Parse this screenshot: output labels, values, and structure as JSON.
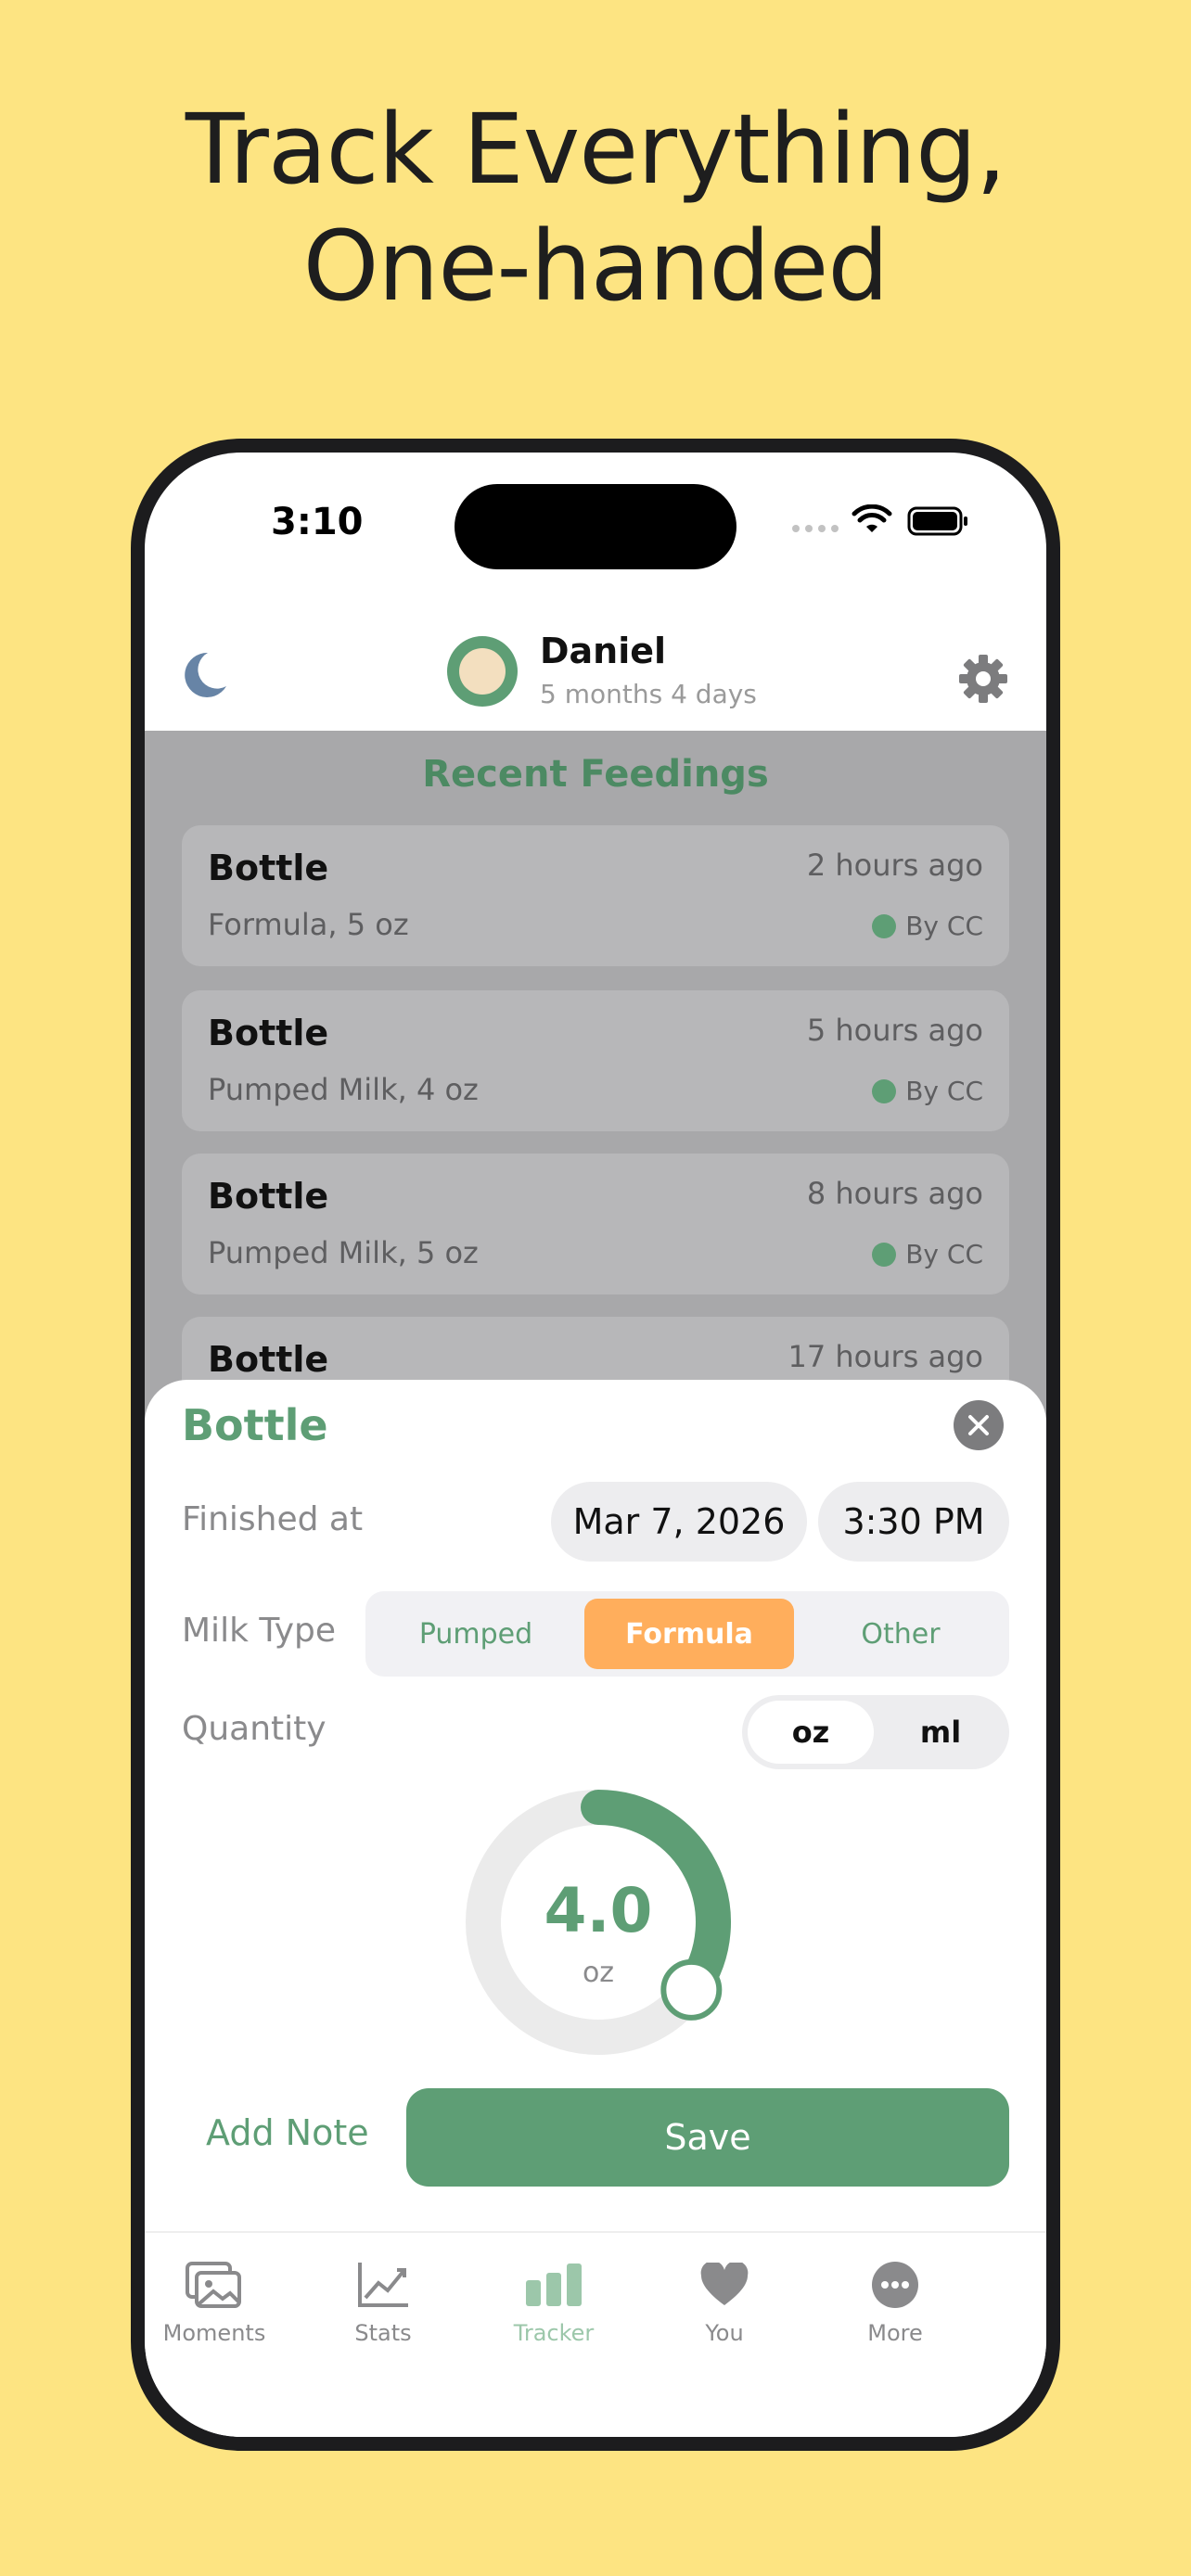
{
  "headline": {
    "line1": "Track Everything,",
    "line2": "One-handed"
  },
  "status_bar": {
    "time": "3:10"
  },
  "header": {
    "baby_name": "Daniel",
    "baby_age": "5 months 4 days"
  },
  "recent": {
    "title": "Recent Feedings",
    "items": [
      {
        "type": "Bottle",
        "detail": "Formula, 5 oz",
        "time": "2 hours ago",
        "by": "By CC"
      },
      {
        "type": "Bottle",
        "detail": "Pumped Milk, 4 oz",
        "time": "5 hours ago",
        "by": "By CC"
      },
      {
        "type": "Bottle",
        "detail": "Pumped Milk, 5 oz",
        "time": "8 hours ago",
        "by": "By CC"
      },
      {
        "type": "Bottle",
        "detail": "",
        "time": "17 hours ago",
        "by": ""
      }
    ]
  },
  "sheet": {
    "title": "Bottle",
    "finished_label": "Finished at",
    "date": "Mar 7, 2026",
    "time": "3:30 PM",
    "milk_label": "Milk Type",
    "milk_options": [
      "Pumped",
      "Formula",
      "Other"
    ],
    "milk_selected": "Formula",
    "quantity_label": "Quantity",
    "units": [
      "oz",
      "ml"
    ],
    "unit_selected": "oz",
    "quantity_value": "4.0",
    "quantity_unit": "oz",
    "dial_fraction": 0.35,
    "add_note": "Add Note",
    "save": "Save"
  },
  "tabbar": {
    "items": [
      {
        "label": "Moments",
        "icon": "photos-icon"
      },
      {
        "label": "Stats",
        "icon": "chart-line-icon"
      },
      {
        "label": "Tracker",
        "icon": "bars-icon",
        "active": true
      },
      {
        "label": "You",
        "icon": "heart-icon"
      },
      {
        "label": "More",
        "icon": "more-dots-icon"
      }
    ]
  },
  "colors": {
    "background": "#FDE482",
    "accent": "#5E9E75",
    "selected": "#FFAE5C"
  }
}
